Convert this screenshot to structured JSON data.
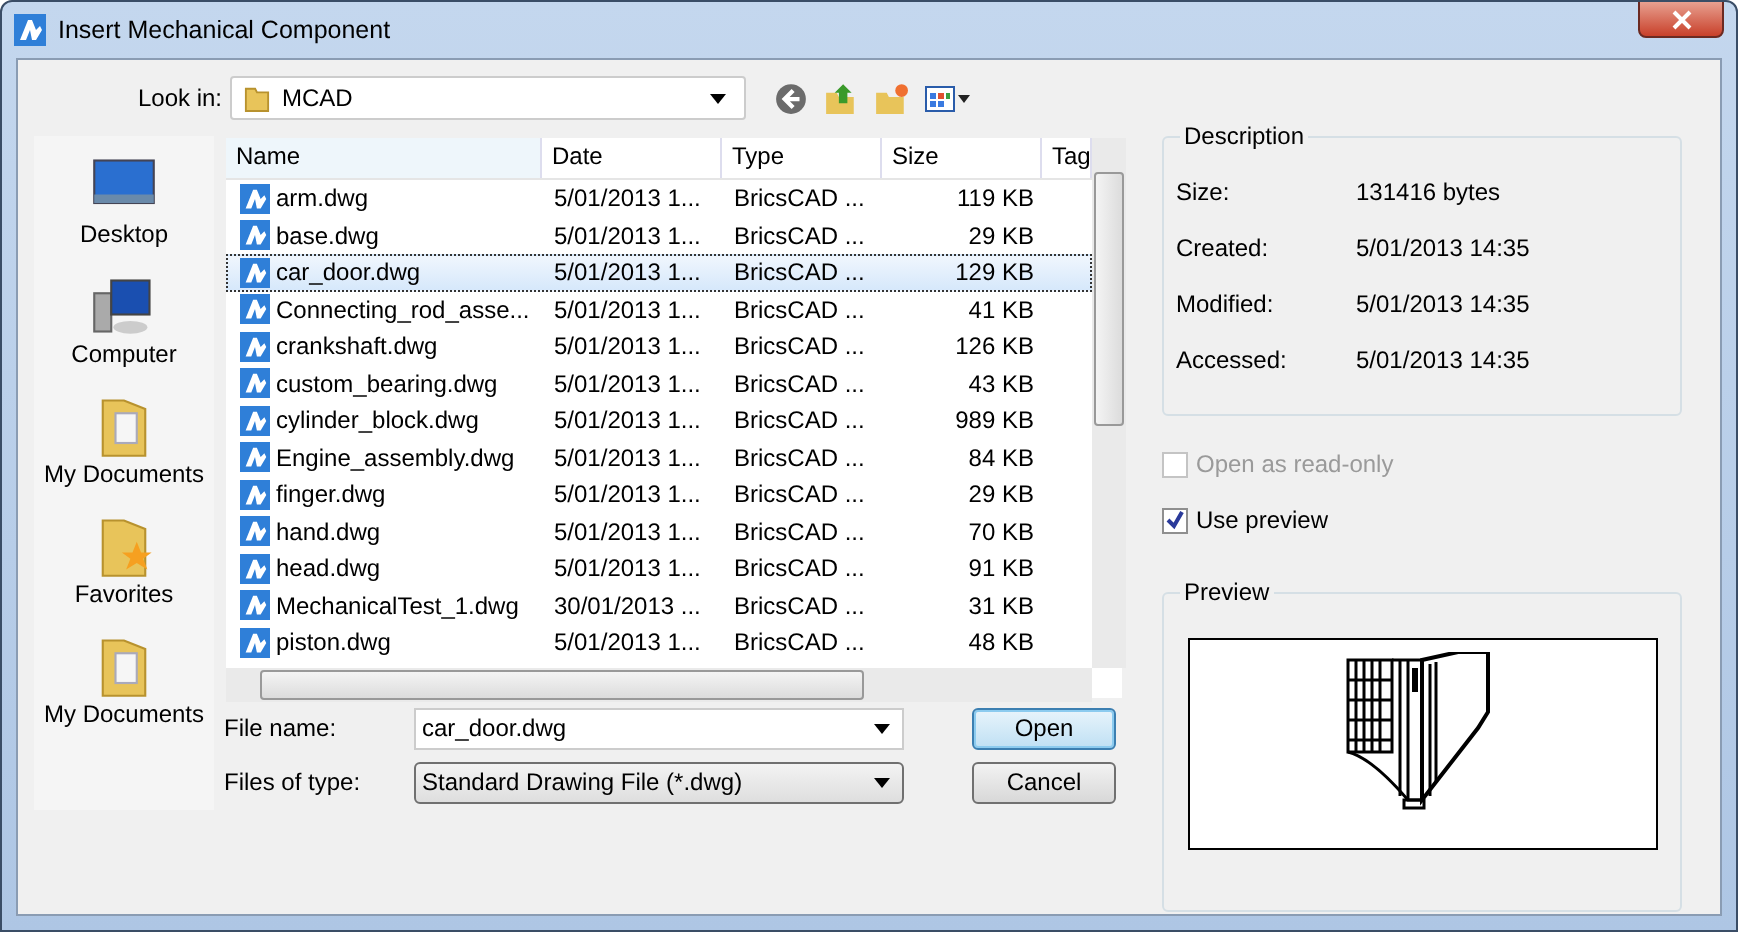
{
  "window": {
    "title": "Insert Mechanical Component"
  },
  "look_in": {
    "label": "Look in:",
    "value": "MCAD"
  },
  "places": [
    {
      "label": "Desktop",
      "kind": "desktop"
    },
    {
      "label": "Computer",
      "kind": "computer"
    },
    {
      "label": "My Documents",
      "kind": "documents"
    },
    {
      "label": "Favorites",
      "kind": "favorites"
    },
    {
      "label": "My Documents",
      "kind": "documents"
    }
  ],
  "table": {
    "columns": [
      "Name",
      "Date",
      "Type",
      "Size",
      "Tag"
    ],
    "rows": [
      {
        "name": "arm.dwg",
        "date": "5/01/2013 1...",
        "type": "BricsCAD ...",
        "size": "119 KB",
        "selected": false
      },
      {
        "name": "base.dwg",
        "date": "5/01/2013 1...",
        "type": "BricsCAD ...",
        "size": "29 KB",
        "selected": false
      },
      {
        "name": "car_door.dwg",
        "date": "5/01/2013 1...",
        "type": "BricsCAD ...",
        "size": "129 KB",
        "selected": true
      },
      {
        "name": "Connecting_rod_asse...",
        "date": "5/01/2013 1...",
        "type": "BricsCAD ...",
        "size": "41 KB",
        "selected": false
      },
      {
        "name": "crankshaft.dwg",
        "date": "5/01/2013 1...",
        "type": "BricsCAD ...",
        "size": "126 KB",
        "selected": false
      },
      {
        "name": "custom_bearing.dwg",
        "date": "5/01/2013 1...",
        "type": "BricsCAD ...",
        "size": "43 KB",
        "selected": false
      },
      {
        "name": "cylinder_block.dwg",
        "date": "5/01/2013 1...",
        "type": "BricsCAD ...",
        "size": "989 KB",
        "selected": false
      },
      {
        "name": "Engine_assembly.dwg",
        "date": "5/01/2013 1...",
        "type": "BricsCAD ...",
        "size": "84 KB",
        "selected": false
      },
      {
        "name": "finger.dwg",
        "date": "5/01/2013 1...",
        "type": "BricsCAD ...",
        "size": "29 KB",
        "selected": false
      },
      {
        "name": "hand.dwg",
        "date": "5/01/2013 1...",
        "type": "BricsCAD ...",
        "size": "70 KB",
        "selected": false
      },
      {
        "name": "head.dwg",
        "date": "5/01/2013 1...",
        "type": "BricsCAD ...",
        "size": "91 KB",
        "selected": false
      },
      {
        "name": "MechanicalTest_1.dwg",
        "date": "30/01/2013 ...",
        "type": "BricsCAD ...",
        "size": "31 KB",
        "selected": false
      },
      {
        "name": "piston.dwg",
        "date": "5/01/2013 1...",
        "type": "BricsCAD ...",
        "size": "48 KB",
        "selected": false
      }
    ]
  },
  "file_name": {
    "label": "File name:",
    "value": "car_door.dwg"
  },
  "file_type": {
    "label": "Files of type:",
    "value": "Standard Drawing File (*.dwg)"
  },
  "buttons": [
    "Open",
    "Cancel"
  ],
  "description": {
    "title": "Description",
    "fields": [
      {
        "label": "Size:",
        "value": "131416 bytes"
      },
      {
        "label": "Created:",
        "value": "5/01/2013 14:35"
      },
      {
        "label": "Modified:",
        "value": "5/01/2013 14:35"
      },
      {
        "label": "Accessed:",
        "value": "5/01/2013 14:35"
      }
    ]
  },
  "options": [
    {
      "label": "Open as read-only",
      "checked": false,
      "disabled": true
    },
    {
      "label": "Use preview",
      "checked": true,
      "disabled": false
    }
  ],
  "preview": {
    "title": "Preview"
  }
}
